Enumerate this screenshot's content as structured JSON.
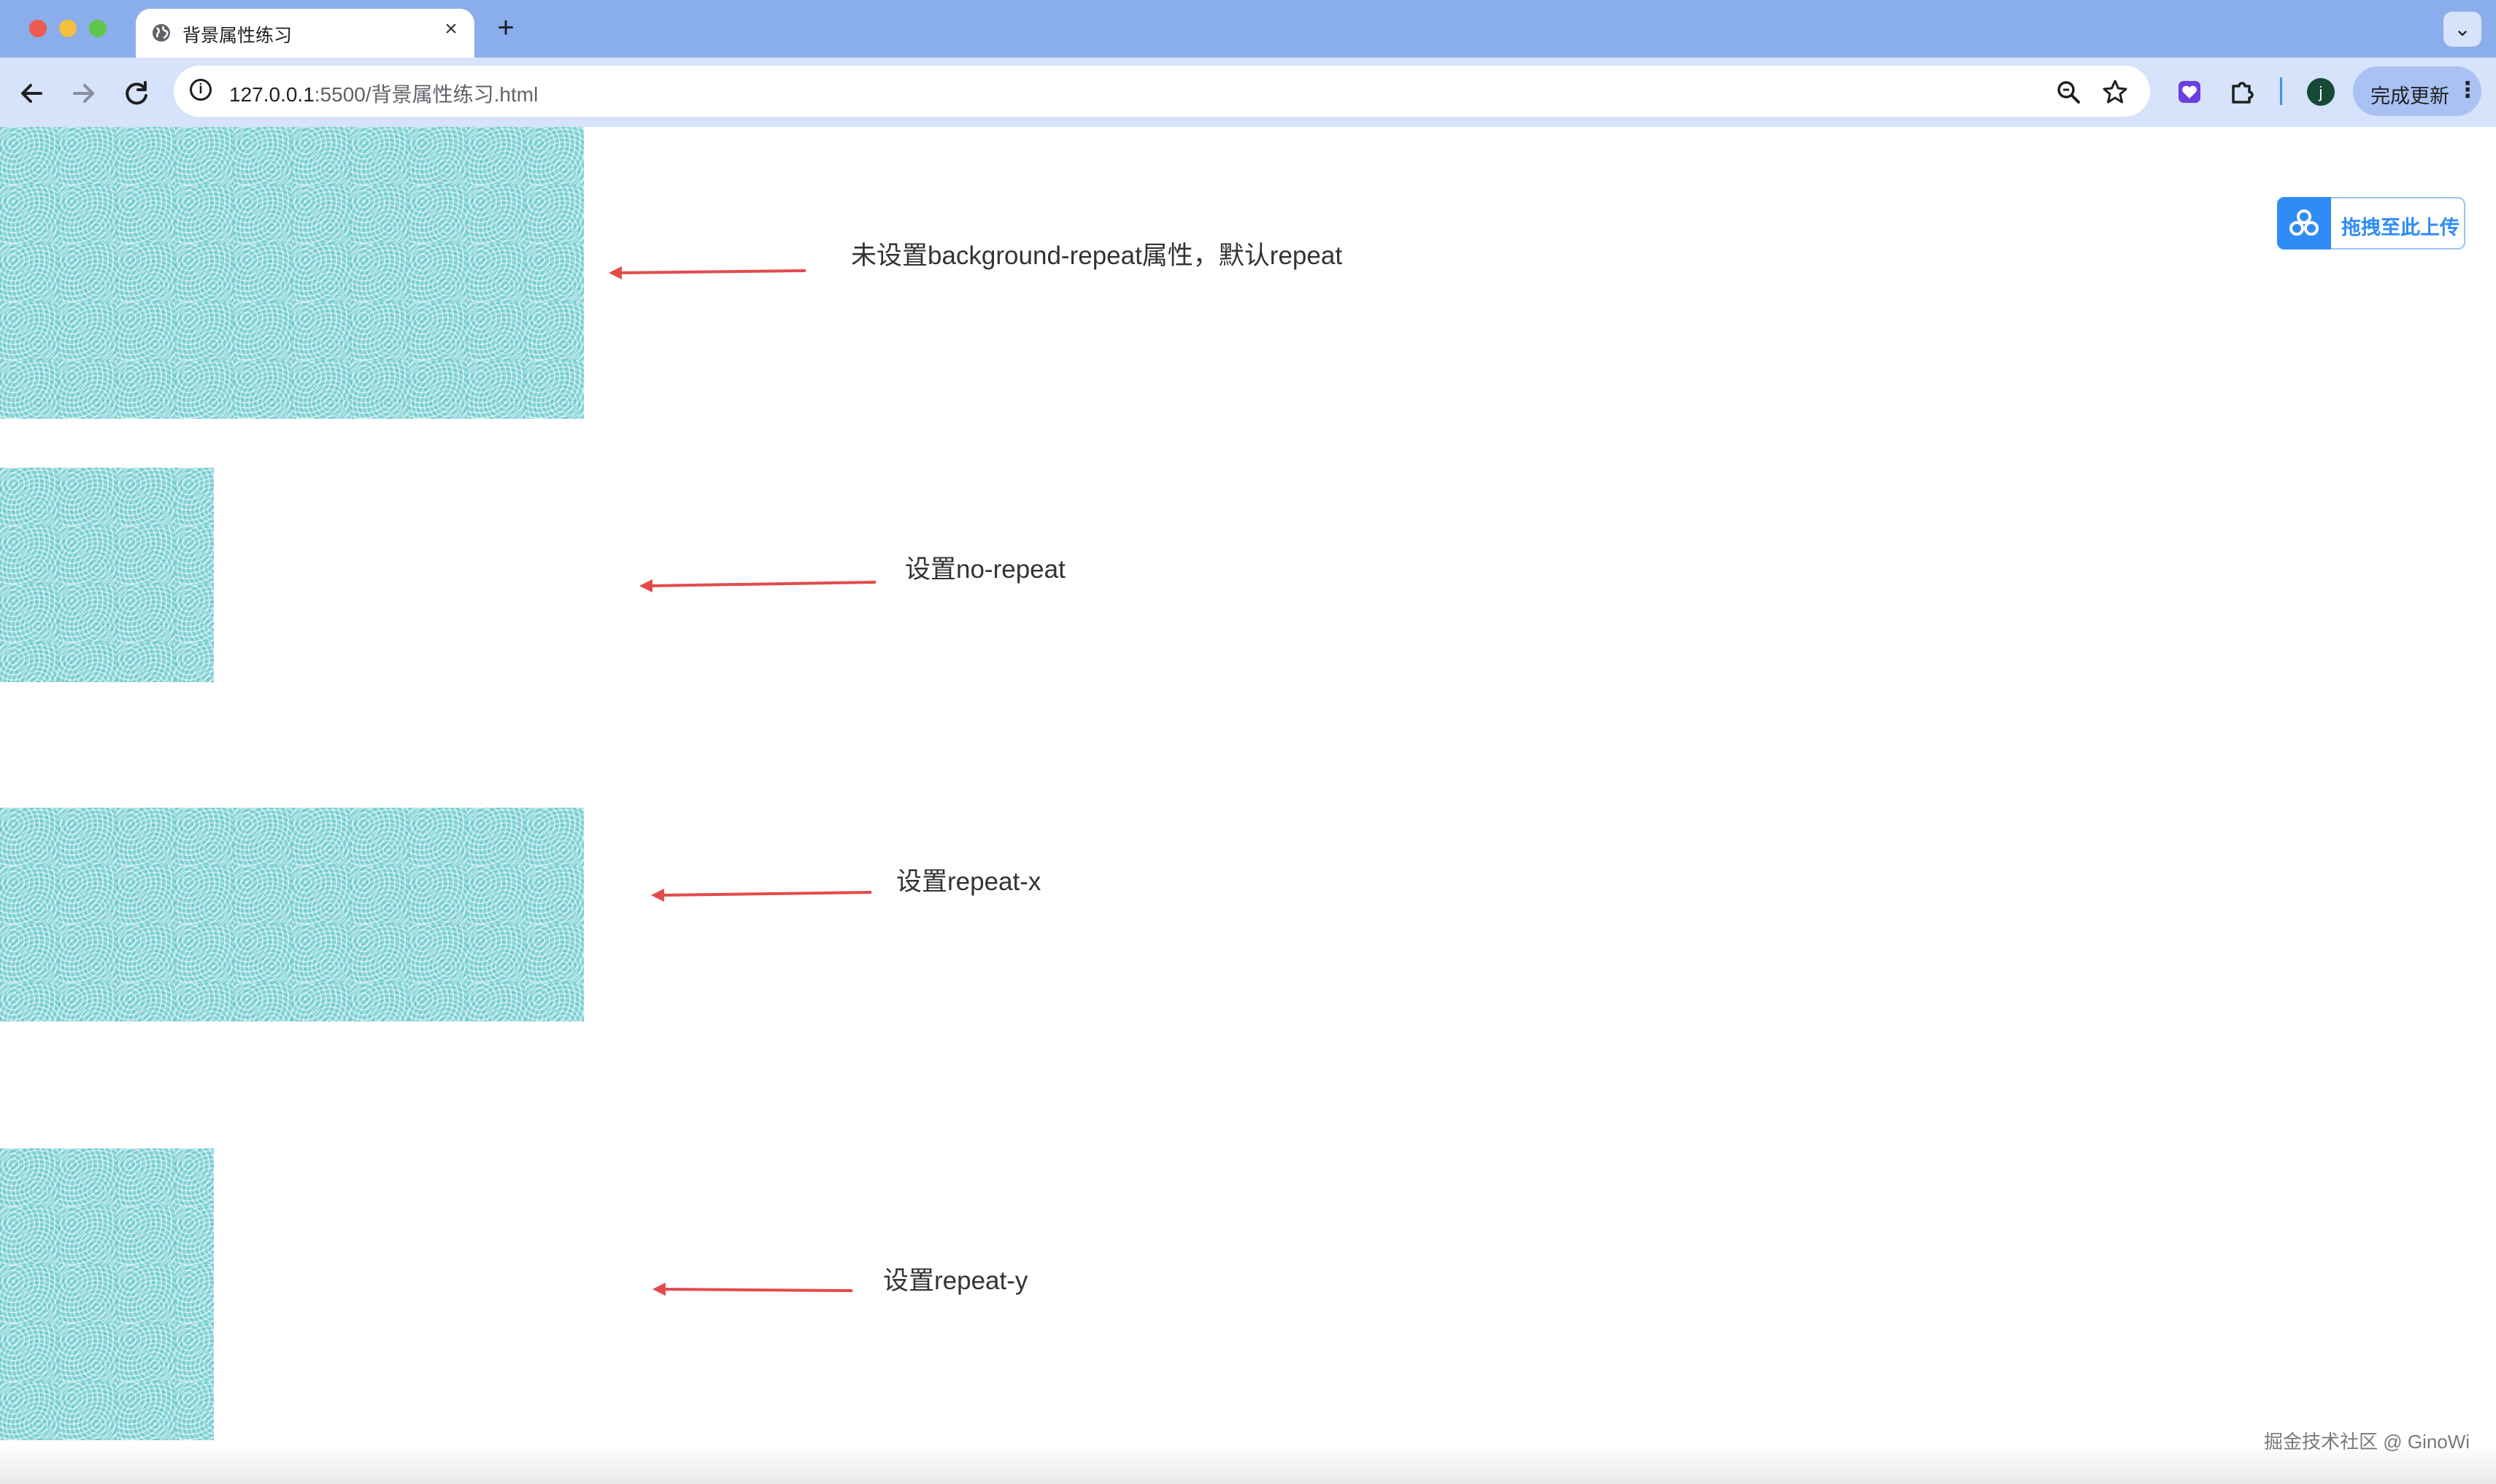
{
  "browser": {
    "tab": {
      "title": "背景属性练习",
      "close": "×"
    },
    "new_tab": "+",
    "tab_search": "⌄",
    "address": {
      "host": "127.0.0.1",
      "rest": ":5500/背景属性练习.html"
    },
    "profile_initial": "j",
    "update_button": "完成更新",
    "menu": "⋮"
  },
  "page": {
    "annotations": [
      "未设置background-repeat属性，默认repeat",
      "设置no-repeat",
      "设置repeat-x",
      "设置repeat-y"
    ],
    "baidu_upload": "拖拽至此上传",
    "watermark": "掘金技术社区 @ GinoWi"
  },
  "colors": {
    "tabstrip": "#8aadec",
    "toolbar": "#d6e3fb",
    "arrow": "#e34b4b",
    "pattern": "#7fd2d5",
    "baidu_blue": "#2f8cf5"
  }
}
